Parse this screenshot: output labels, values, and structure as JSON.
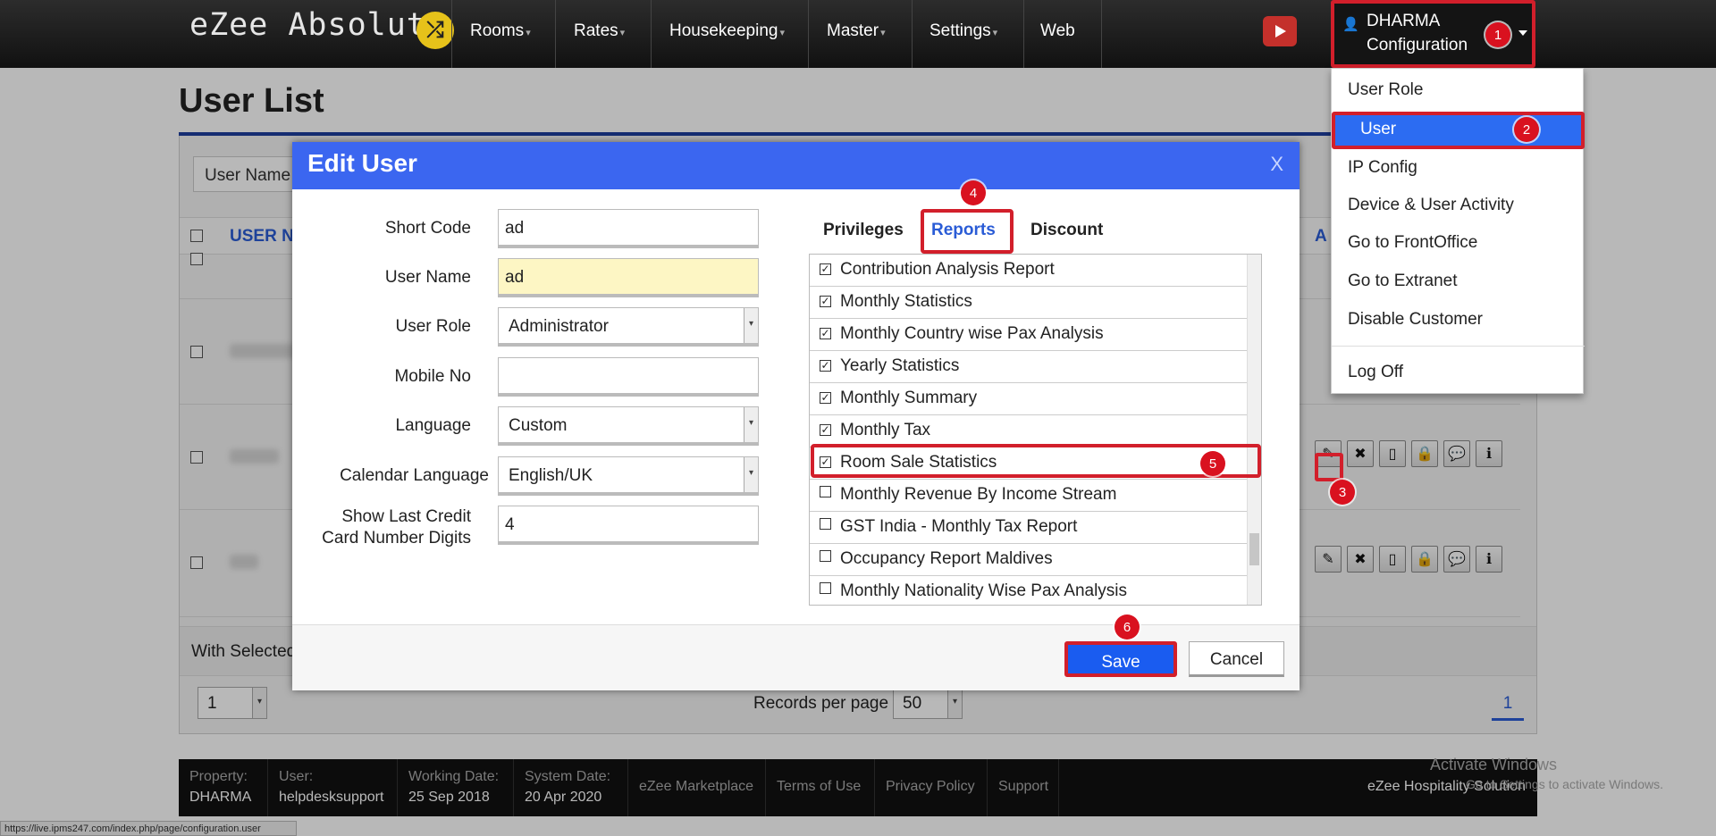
{
  "nav": {
    "brand": "eZee Absolute",
    "brand_icon": "shuffle-icon",
    "items": [
      {
        "label": "Rooms",
        "caret": "▾"
      },
      {
        "label": "Rates",
        "caret": "▾"
      },
      {
        "label": "Housekeeping",
        "caret": "▾"
      },
      {
        "label": "Master",
        "caret": "▾"
      },
      {
        "label": "Settings",
        "caret": "▾"
      },
      {
        "label": "Web",
        "caret": ""
      }
    ],
    "user_line1": "DHARMA",
    "user_line2": "Configuration"
  },
  "user_dropdown": {
    "items": [
      "User Role",
      "User",
      "IP Config",
      "Device & User Activity",
      "Go to FrontOffice",
      "Go to Extranet",
      "Disable Customer",
      "Log Off"
    ],
    "selected": "User"
  },
  "page": {
    "title": "User List",
    "filter_label": "User Name",
    "column_username": "USER N",
    "column_action": "A",
    "with_selected": "With Selected",
    "page_select": "1",
    "records_per_page_label": "Records per page",
    "records_per_page": "50",
    "current_page": "1"
  },
  "modal": {
    "title": "Edit User",
    "close": "X",
    "fields": [
      {
        "label": "Short Code",
        "value": "ad"
      },
      {
        "label": "User Name",
        "value": "ad"
      },
      {
        "label": "User Role",
        "value": "Administrator"
      },
      {
        "label": "Mobile No",
        "value": ""
      },
      {
        "label": "Language",
        "value": "Custom"
      },
      {
        "label": "Calendar Language",
        "value": "English/UK"
      },
      {
        "label_line1": "Show Last Credit",
        "label_line2": "Card Number Digits",
        "value": "4"
      }
    ],
    "tabs": [
      "Privileges",
      "Reports",
      "Discount"
    ],
    "active_tab": "Reports",
    "reports": [
      {
        "label": "Contribution Analysis Report",
        "checked": true
      },
      {
        "label": "Monthly Statistics",
        "checked": true
      },
      {
        "label": "Monthly Country wise Pax Analysis",
        "checked": true
      },
      {
        "label": "Yearly Statistics",
        "checked": true
      },
      {
        "label": "Monthly Summary",
        "checked": true
      },
      {
        "label": "Monthly Tax",
        "checked": true
      },
      {
        "label": "Room Sale Statistics",
        "checked": true
      },
      {
        "label": "Monthly Revenue By Income Stream",
        "checked": false
      },
      {
        "label": "GST India - Monthly Tax Report",
        "checked": false
      },
      {
        "label": "Occupancy Report Maldives",
        "checked": false
      },
      {
        "label": "Monthly Nationality Wise Pax Analysis",
        "checked": false
      }
    ],
    "save": "Save",
    "cancel": "Cancel"
  },
  "badges": [
    "1",
    "2",
    "3",
    "4",
    "5",
    "6"
  ],
  "footer": {
    "property_label": "Property:",
    "property": "DHARMA",
    "user_label": "User:",
    "user": "helpdesksupport",
    "working_date_label": "Working Date:",
    "working_date": "25 Sep 2018",
    "system_date_label": "System Date:",
    "system_date": "20 Apr 2020",
    "links": [
      "eZee Marketplace",
      "Terms of Use",
      "Privacy Policy",
      "Support"
    ],
    "solution": "eZee Hospitality Solution"
  },
  "windows_activation": {
    "title": "Activate Windows",
    "subtitle": "Go to Settings to activate Windows."
  },
  "status_url": "https://live.ipms247.com/index.php/page/configuration.user",
  "colors": {
    "accent": "#3b66f0",
    "highlight": "#d21f2b",
    "navbar": "#1a1a1a"
  }
}
